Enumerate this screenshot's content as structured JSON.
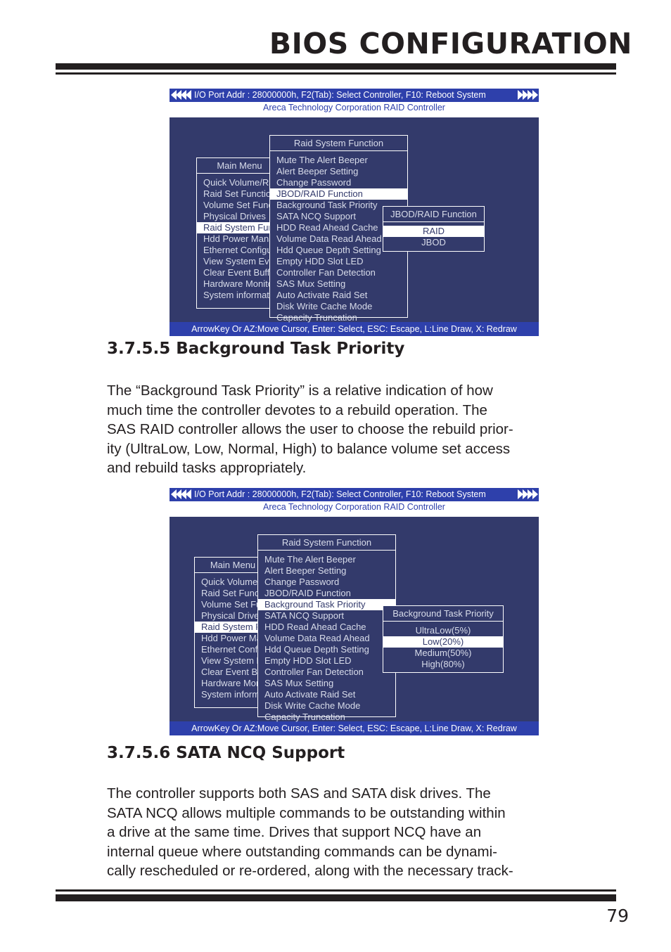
{
  "page": {
    "header_title": "BIOS CONFIGURATION",
    "page_number": "79"
  },
  "bios_screen_1": {
    "topbar": "I/O Port Addr : 28000000h, F2(Tab): Select Controller, F10: Reboot System",
    "subtitle": "Areca Technology Corporation RAID Controller",
    "statusbar": "ArrowKey Or AZ:Move Cursor, Enter: Select, ESC: Escape, L:Line Draw, X: Redraw",
    "main_menu": {
      "title": "Main Menu",
      "items": [
        {
          "label": "Quick Volume/Raid Setup",
          "selected": false
        },
        {
          "label": "Raid Set Function",
          "selected": false
        },
        {
          "label": "Volume Set Function",
          "selected": false
        },
        {
          "label": "Physical Drives",
          "selected": false
        },
        {
          "label": "Raid System Function",
          "selected": true
        },
        {
          "label": "Hdd Power Management",
          "selected": false
        },
        {
          "label": "Ethernet Configuration",
          "selected": false
        },
        {
          "label": "View System Events",
          "selected": false
        },
        {
          "label": "Clear Event Buffer",
          "selected": false
        },
        {
          "label": "Hardware Monitor",
          "selected": false
        },
        {
          "label": "System information",
          "selected": false
        }
      ]
    },
    "raid_system_function": {
      "title": "Raid System Function",
      "items": [
        {
          "label": "Mute The Alert Beeper",
          "selected": false
        },
        {
          "label": "Alert Beeper Setting",
          "selected": false
        },
        {
          "label": "Change Password",
          "selected": false
        },
        {
          "label": "JBOD/RAID Function",
          "selected": true
        },
        {
          "label": "Background Task Priority",
          "selected": false
        },
        {
          "label": "SATA NCQ Support",
          "selected": false
        },
        {
          "label": "HDD Read Ahead Cache",
          "selected": false
        },
        {
          "label": "Volume Data Read Ahead",
          "selected": false
        },
        {
          "label": "Hdd Queue Depth Setting",
          "selected": false
        },
        {
          "label": "Empty HDD Slot LED",
          "selected": false
        },
        {
          "label": "Controller Fan Detection",
          "selected": false
        },
        {
          "label": "SAS Mux Setting",
          "selected": false
        },
        {
          "label": "Auto Activate Raid Set",
          "selected": false
        },
        {
          "label": "Disk Write Cache Mode",
          "selected": false
        },
        {
          "label": "Capacity Truncation",
          "selected": false
        }
      ]
    },
    "submenu": {
      "title": "JBOD/RAID Function",
      "items": [
        {
          "label": "RAID",
          "selected": true
        },
        {
          "label": "JBOD",
          "selected": false
        }
      ]
    }
  },
  "section_1": {
    "heading": "3.7.5.5 Background Task Priority",
    "paragraph_lines": [
      "The “Background Task Priority” is a relative indication of how",
      "much time the controller devotes to a rebuild operation. The",
      "SAS RAID controller allows the user to choose the rebuild prior-",
      "ity (UltraLow, Low, Normal, High) to balance volume set access",
      "and rebuild tasks appropriately."
    ]
  },
  "bios_screen_2": {
    "topbar": "I/O Port Addr : 28000000h, F2(Tab): Select Controller, F10: Reboot System",
    "subtitle": "Areca Technology Corporation RAID Controller",
    "statusbar": "ArrowKey Or AZ:Move Cursor, Enter: Select, ESC: Escape, L:Line Draw, X: Redraw",
    "main_menu": {
      "title": "Main Menu",
      "items": [
        {
          "label": "Quick Volume/Raid Setup",
          "selected": false
        },
        {
          "label": "Raid Set Function",
          "selected": false
        },
        {
          "label": "Volume Set Function",
          "selected": false
        },
        {
          "label": "Physical Drives",
          "selected": false
        },
        {
          "label": "Raid System Function",
          "selected": true
        },
        {
          "label": "Hdd Power Management",
          "selected": false
        },
        {
          "label": "Ethernet Configuration",
          "selected": false
        },
        {
          "label": "View System Events",
          "selected": false
        },
        {
          "label": "Clear Event Buffer",
          "selected": false
        },
        {
          "label": "Hardware Monitor",
          "selected": false
        },
        {
          "label": "System information",
          "selected": false
        }
      ]
    },
    "raid_system_function": {
      "title": "Raid System Function",
      "items": [
        {
          "label": "Mute The Alert Beeper",
          "selected": false
        },
        {
          "label": "Alert Beeper Setting",
          "selected": false
        },
        {
          "label": "Change Password",
          "selected": false
        },
        {
          "label": "JBOD/RAID Function",
          "selected": false
        },
        {
          "label": "Background Task Priority",
          "selected": true
        },
        {
          "label": "SATA NCQ Support",
          "selected": false
        },
        {
          "label": "HDD Read Ahead Cache",
          "selected": false
        },
        {
          "label": "Volume Data Read Ahead",
          "selected": false
        },
        {
          "label": "Hdd Queue Depth Setting",
          "selected": false
        },
        {
          "label": "Empty HDD Slot LED",
          "selected": false
        },
        {
          "label": "Controller Fan Detection",
          "selected": false
        },
        {
          "label": "SAS Mux Setting",
          "selected": false
        },
        {
          "label": "Auto Activate Raid Set",
          "selected": false
        },
        {
          "label": "Disk Write Cache Mode",
          "selected": false
        },
        {
          "label": "Capacity Truncation",
          "selected": false
        }
      ]
    },
    "submenu": {
      "title": "Background Task Priority",
      "items": [
        {
          "label": "UltraLow(5%)",
          "selected": false
        },
        {
          "label": "Low(20%)",
          "selected": true
        },
        {
          "label": "Medium(50%)",
          "selected": false
        },
        {
          "label": "High(80%)",
          "selected": false
        }
      ]
    }
  },
  "section_2": {
    "heading": "3.7.5.6 SATA NCQ Support",
    "paragraph_lines": [
      "The controller supports both SAS and SATA disk drives. The",
      "SATA NCQ allows multiple commands to be outstanding within",
      "a drive at the same time. Drives that support NCQ have an",
      "internal queue where outstanding commands can be dynami-",
      "cally rescheduled or re-ordered, along with the necessary track-"
    ]
  },
  "colors": {
    "bios_bar": "#2e40ab",
    "bios_body": "#333a6b",
    "bios_text": "#d8dcea",
    "rule": "#231f20"
  }
}
